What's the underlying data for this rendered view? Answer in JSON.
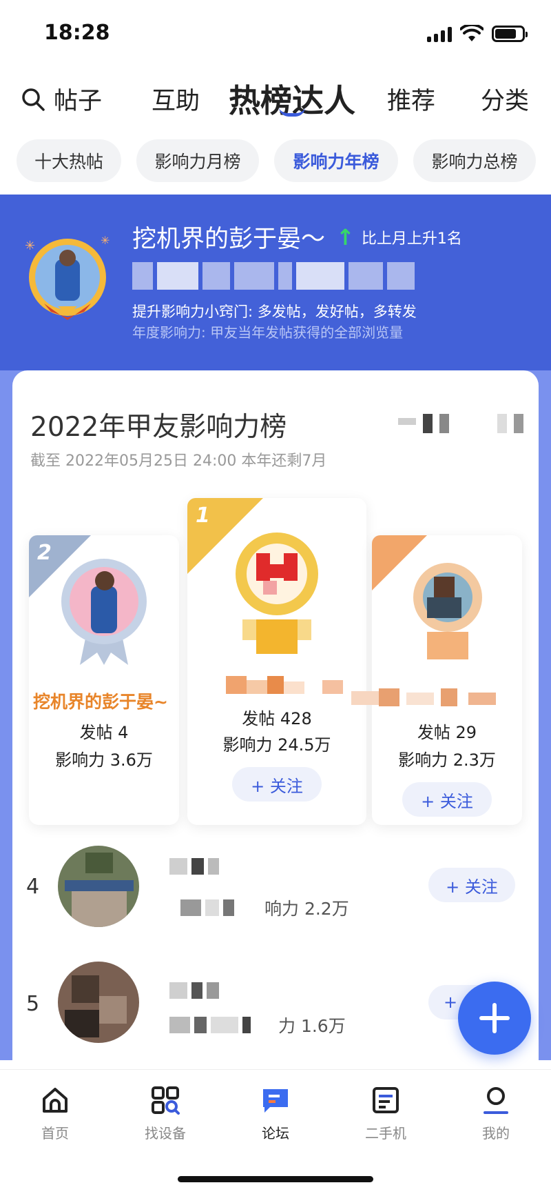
{
  "status_bar": {
    "time": "18:28"
  },
  "top_nav": {
    "search_label": "帖子",
    "items": [
      "互助",
      "热榜达人",
      "推荐",
      "分类"
    ],
    "active_index": 1
  },
  "tabs": [
    "十大热帖",
    "影响力月榜",
    "影响力年榜",
    "影响力总榜"
  ],
  "active_tab": 2,
  "banner": {
    "name": "挖机界的彭于晏～",
    "rise_arrow": "↑",
    "rise_text": "比上月上升1名",
    "tip": "提升影响力小窍门: 多发帖，发好帖，多转发",
    "desc": "年度影响力: 甲友当年发帖获得的全部浏览量"
  },
  "board": {
    "title": "2022年甲友影响力榜",
    "subtitle": "截至 2022年05月25日 24:00 本年还剩7月"
  },
  "podium": {
    "second": {
      "rank": "2",
      "name": "挖机界的彭于晏~",
      "posts": "发帖 4",
      "influence": "影响力 3.6万"
    },
    "first": {
      "rank": "1",
      "posts": "发帖 428",
      "influence": "影响力 24.5万",
      "follow": "+ 关注"
    },
    "third": {
      "posts": "发帖 29",
      "influence": "影响力 2.3万",
      "follow": "+ 关注"
    }
  },
  "list": [
    {
      "rank": "4",
      "influence": "响力 2.2万",
      "follow": "+ 关注"
    },
    {
      "rank": "5",
      "influence": "力 1.6万",
      "follow": "+"
    }
  ],
  "bottom_nav": {
    "items": [
      "首页",
      "找设备",
      "论坛",
      "二手机",
      "我的"
    ],
    "active_index": 2
  },
  "colors": {
    "accent": "#3b5bdb",
    "banner": "#4361d8",
    "gold": "#e8852a",
    "rise": "#37d66a"
  }
}
